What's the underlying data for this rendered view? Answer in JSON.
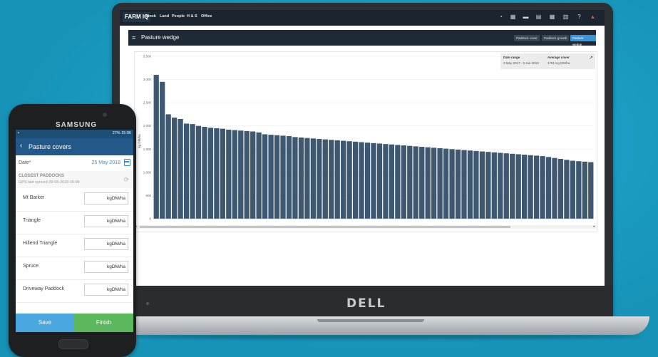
{
  "laptop": {
    "brand": "DELL",
    "nav": {
      "logo": "FARM IQ",
      "items": [
        "Stock",
        "Land",
        "People",
        "H & S",
        "Office"
      ],
      "icons": [
        "speedometer-icon",
        "chart-icon",
        "folder-icon",
        "calendar-icon",
        "grid-icon",
        "map-icon",
        "help-icon",
        "alert-icon"
      ]
    },
    "page_title": "Pasture wedge",
    "view_buttons": [
      "Paddock cover",
      "Paddock growth",
      "Pasture wedge"
    ],
    "info": {
      "date_range_label": "Date range",
      "date_range_value": "3 May 2017 - 6 Jun 2018",
      "avg_cover_label": "Average cover",
      "avg_cover_value": "1781 Kg DM/ha"
    }
  },
  "chart_data": {
    "type": "bar",
    "ylabel": "kg DM/ha",
    "ylim": [
      0,
      3500
    ],
    "yticks": [
      "0",
      "500",
      "1,000",
      "1,500",
      "2,000",
      "2,500",
      "3,000",
      "3,500"
    ],
    "values": [
      3100,
      2950,
      2250,
      2180,
      2150,
      2050,
      2040,
      2000,
      1980,
      1960,
      1950,
      1940,
      1920,
      1910,
      1900,
      1890,
      1880,
      1860,
      1820,
      1810,
      1800,
      1790,
      1780,
      1760,
      1750,
      1740,
      1730,
      1720,
      1710,
      1700,
      1690,
      1680,
      1670,
      1660,
      1650,
      1640,
      1630,
      1620,
      1610,
      1600,
      1590,
      1580,
      1570,
      1560,
      1550,
      1540,
      1530,
      1520,
      1510,
      1500,
      1490,
      1480,
      1470,
      1460,
      1450,
      1440,
      1430,
      1420,
      1410,
      1400,
      1390,
      1380,
      1370,
      1360,
      1350,
      1330,
      1310,
      1290,
      1270,
      1250,
      1240,
      1230,
      1220
    ],
    "grid": true
  },
  "phone": {
    "brand": "SAMSUNG",
    "status": "27% 15:06",
    "app_bar_title": "Pasture covers",
    "date_label": "Date",
    "date_value": "25 May 2018",
    "closest_title": "CLOSEST PADDOCKS",
    "gps_text": "GPS last synced 25-05-2018 15:06",
    "paddocks": [
      {
        "name": "Mt Barker",
        "unit": "kgDM/ha"
      },
      {
        "name": "Triangle",
        "unit": "kgDM/ha"
      },
      {
        "name": "Hillend Triangle",
        "unit": "kgDM/ha"
      },
      {
        "name": "Spruce",
        "unit": "kgDM/ha"
      },
      {
        "name": "Driveway Paddock",
        "unit": "kgDM/ha"
      }
    ],
    "save_label": "Save",
    "finish_label": "Finish"
  },
  "colors": {
    "background": "#1b9bc1",
    "bar": "#3f5872",
    "header": "#1f2a37",
    "active_button": "#3a96d6",
    "save": "#4ba7df",
    "finish": "#5cb85c"
  }
}
